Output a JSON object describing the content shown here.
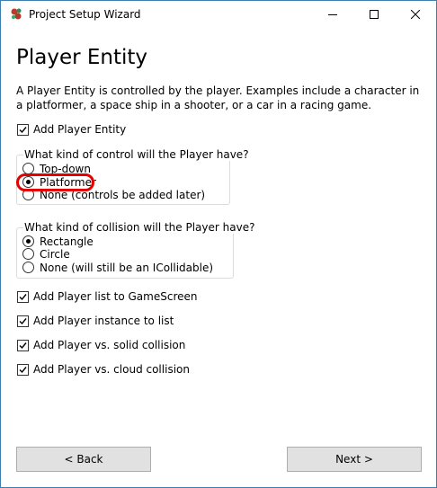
{
  "window": {
    "title": "Project Setup Wizard"
  },
  "page": {
    "heading": "Player Entity",
    "description": "A Player Entity is controlled by the player. Examples include a character in a platformer, a space ship in a shooter, or a car in a racing game."
  },
  "add_player_entity": {
    "label": "Add Player Entity",
    "checked": true
  },
  "control_group": {
    "label": "What kind of control will the Player have?",
    "options": [
      {
        "label": "Top-down",
        "selected": false
      },
      {
        "label": "Platformer",
        "selected": true
      },
      {
        "label": "None (controls be added later)",
        "selected": false
      }
    ]
  },
  "collision_group": {
    "label": "What kind of collision will the Player have?",
    "options": [
      {
        "label": "Rectangle",
        "selected": true
      },
      {
        "label": "Circle",
        "selected": false
      },
      {
        "label": "None (will still be an ICollidable)",
        "selected": false
      }
    ]
  },
  "options": [
    {
      "label": "Add Player list to GameScreen",
      "checked": true
    },
    {
      "label": "Add Player instance to list",
      "checked": true
    },
    {
      "label": "Add Player vs. solid collision",
      "checked": true
    },
    {
      "label": "Add Player vs. cloud collision",
      "checked": true
    }
  ],
  "buttons": {
    "back": "< Back",
    "next": "Next >"
  },
  "colors": {
    "highlight": "#e40000",
    "button_bg": "#e1e1e1",
    "group_border": "#dcdcdc"
  }
}
